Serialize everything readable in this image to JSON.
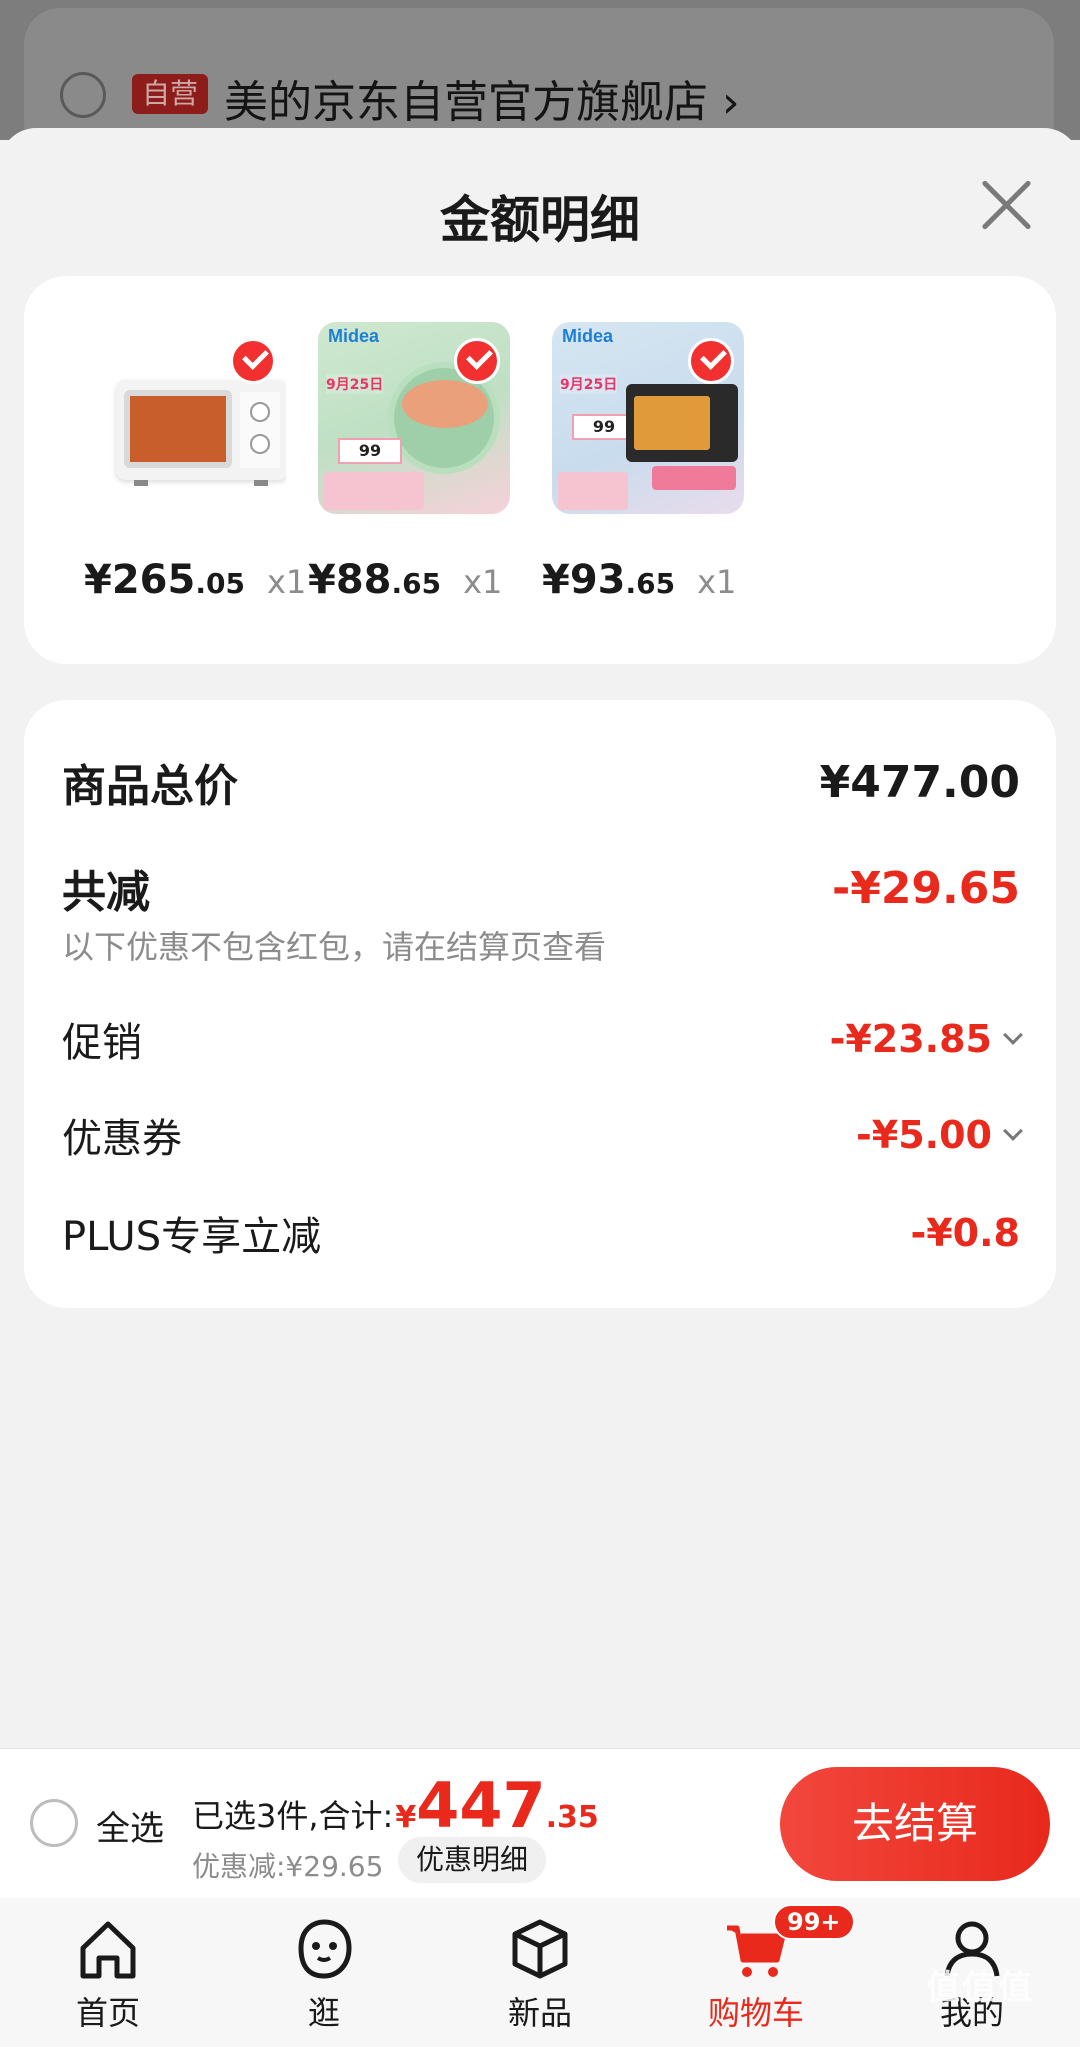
{
  "background": {
    "badge": "自营",
    "store_name": "美的京东自营官方旗舰店",
    "chevron": "›"
  },
  "sheet": {
    "title": "金额明细"
  },
  "products": [
    {
      "price_int": "¥265",
      "price_dec": ".05",
      "qty": "x1",
      "image": "microwave"
    },
    {
      "price_int": "¥88",
      "price_dec": ".65",
      "qty": "x1",
      "image": "midea-hotpot-poster"
    },
    {
      "price_int": "¥93",
      "price_dec": ".65",
      "qty": "x1",
      "image": "midea-oven-poster"
    }
  ],
  "posters": {
    "logo": "Midea",
    "date": "9月25日",
    "price": "99"
  },
  "summary": {
    "total_label": "商品总价",
    "total_value": "¥477.00",
    "reduce_label": "共减",
    "reduce_value": "-¥29.65",
    "note": "以下优惠不包含红包，请在结算页查看",
    "promo_label": "促销",
    "promo_value": "-¥23.85",
    "coupon_label": "优惠券",
    "coupon_value": "-¥5.00",
    "plus_label": "PLUS专享立减",
    "plus_value": "-¥0.8"
  },
  "checkout": {
    "select_all": "全选",
    "selected_text": "已选3件,合计:",
    "currency": "¥",
    "total_int": "447",
    "total_dec": ".35",
    "discount_text": "优惠减:¥29.65",
    "detail_button": "优惠明细",
    "checkout_button": "去结算"
  },
  "tabs": [
    {
      "label": "首页",
      "icon": "home-icon"
    },
    {
      "label": "逛",
      "icon": "face-icon"
    },
    {
      "label": "新品",
      "icon": "cube-icon"
    },
    {
      "label": "购物车",
      "icon": "cart-icon",
      "badge": "99+",
      "active": true
    },
    {
      "label": "我的",
      "icon": "user-icon"
    }
  ],
  "watermark": "值值值",
  "colors": {
    "accent": "#e8291c",
    "background": "#f2f2f2"
  }
}
